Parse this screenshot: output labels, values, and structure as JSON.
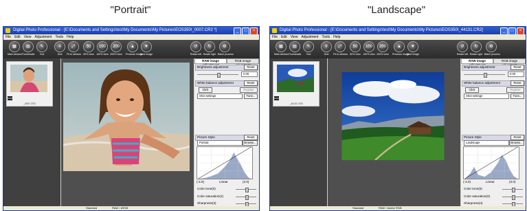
{
  "captions": {
    "left": "\"Portrait\"",
    "right": "\"Landscape\""
  },
  "windows": [
    {
      "title": "Digital Photo Professional - [E:\\Documents and Settings\\test\\My Documents\\My Pictures\\EOS350\\_0007.CR2 *]",
      "thumb_name": "_0007.CR2",
      "picture_style": "Portrait",
      "sharpness": "Sharpness(3)",
      "color_saturation": "Color saturation(2)",
      "color_tone": "Color tone(0)",
      "status_left": "Standard",
      "status_right": "RAW / sRGB"
    },
    {
      "title": "Digital Photo Professional - [E:\\Documents and Settings\\test\\My Documents\\My Pictures\\EOS350\\_44131.CR2]",
      "thumb_name": "_44131.CR2",
      "picture_style": "Landscape",
      "sharpness": "Sharpness(4)",
      "color_saturation": "Color saturation(0)",
      "color_tone": "Color tone(0)",
      "status_left": "Standard",
      "status_right": "RAW / Adobe RGB"
    }
  ],
  "menu": [
    "File",
    "Edit",
    "View",
    "Adjustment",
    "Tools",
    "Help"
  ],
  "toolbar": [
    {
      "label": "Main window",
      "icon": "main-window-icon",
      "glyph": "▦"
    },
    {
      "label": "Thumbnails",
      "icon": "thumbnails-icon",
      "glyph": "▤"
    },
    {
      "label": "Tool",
      "icon": "tool-icon",
      "glyph": "✎"
    },
    {
      "label": "Grid",
      "icon": "grid-icon",
      "glyph": "#"
    },
    {
      "label": "Fit to window",
      "icon": "fit-window-icon",
      "glyph": "⤢"
    },
    {
      "label": "50% view",
      "icon": "zoom-50-icon",
      "glyph": "50"
    },
    {
      "label": "100% view",
      "icon": "zoom-100-icon",
      "glyph": "100"
    },
    {
      "label": "200% view",
      "icon": "zoom-200-icon",
      "glyph": "200"
    },
    {
      "label": "Previous image",
      "icon": "previous-image-icon",
      "glyph": "▲"
    },
    {
      "label": "Next image",
      "icon": "next-image-icon",
      "glyph": "▼"
    },
    {
      "label": "Rotate left",
      "icon": "rotate-left-icon",
      "glyph": "↺"
    },
    {
      "label": "Rotate right",
      "icon": "rotate-right-icon",
      "glyph": "↻"
    },
    {
      "label": "Batch process",
      "icon": "batch-process-icon",
      "glyph": "⚙"
    }
  ],
  "panel": {
    "tab_raw": "RAW image adjustment",
    "tab_rgb": "RGB image adjustment",
    "brightness": "Brightness adjustment",
    "brightness_value": "0.00",
    "reset": "Reset",
    "white_balance": "White balance adjustment",
    "click": "Click",
    "register": "Register",
    "shot_settings": "Shot settings",
    "tune": "Tune...",
    "picture_style_label": "Picture Style",
    "browse": "Browse...",
    "range_min": "(-3.0)",
    "range_max": "(3.0)",
    "linear": "Linear"
  }
}
